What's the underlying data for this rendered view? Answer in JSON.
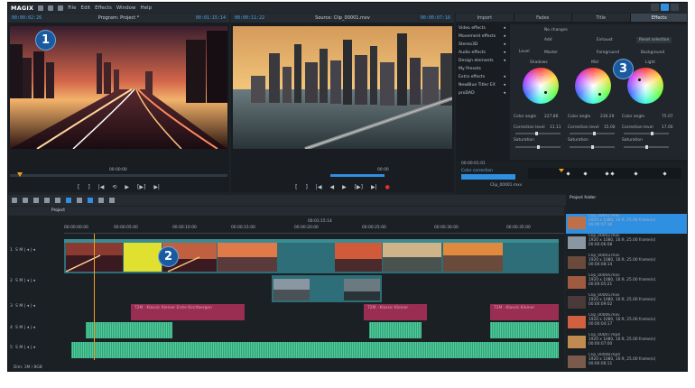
{
  "app": {
    "logo": "MAGIX"
  },
  "menu": [
    "File",
    "Edit",
    "Effects",
    "Window",
    "Help"
  ],
  "program_monitor": {
    "start_tc": "00:00:02:26",
    "title": "Program: Project *",
    "end_tc": "00:01:15:14",
    "position_tc": "00:00:00",
    "badge": "1",
    "controls": [
      "[",
      "]",
      "|◀",
      "⟲",
      "▶",
      "[▶]",
      "▶|"
    ]
  },
  "source_monitor": {
    "start_tc": "00:00:11:22",
    "title": "Source: Clip_00001.mxv",
    "end_tc": "00:00:07:16",
    "position_tc": "00:00",
    "controls": [
      "[",
      "]",
      "|◀",
      "◀",
      "▶",
      "[▶]",
      "▶|",
      "●"
    ]
  },
  "right_tabs": [
    "Import",
    "Fades",
    "Title",
    "Effects"
  ],
  "effects_list": [
    {
      "label": "Video effects",
      "arrow": "◂"
    },
    {
      "label": "Movement effects",
      "arrow": "◂"
    },
    {
      "label": "Stereo3D",
      "arrow": "◂"
    },
    {
      "label": "Audio effects",
      "arrow": "◂"
    },
    {
      "label": "Design elements",
      "arrow": "◂"
    },
    {
      "label": "My Presets",
      "arrow": ""
    },
    {
      "label": "Extra effects",
      "arrow": "◂"
    },
    {
      "label": "NewBlue Titler EX",
      "arrow": "◂"
    },
    {
      "label": "proDAD",
      "arrow": "◂"
    }
  ],
  "color_panel": {
    "badge": "3",
    "no_changes": "No changes",
    "add": "Add",
    "exhaust": "Exhaust",
    "reset_selection": "Reset selection",
    "level": "Level",
    "master": "Master",
    "foreground": "Foreground",
    "background": "Background",
    "wheels": [
      {
        "name": "Shadows",
        "angle_label": "Color angle",
        "angle": "227.86",
        "level_label": "Correction level",
        "level": "11.11",
        "sat_label": "Saturation"
      },
      {
        "name": "Mid",
        "angle_label": "Color angle",
        "angle": "236.29",
        "level_label": "Correction level",
        "level": "15.00",
        "sat_label": "Saturation"
      },
      {
        "name": "Light",
        "angle_label": "Color angle",
        "angle": "75.07",
        "level_label": "Correction level",
        "level": "17.00",
        "sat_label": "Saturation"
      }
    ]
  },
  "keyframe_panel": {
    "tc": "00:00:01:01",
    "track": "Color correction",
    "clip": "Clip_00001.mxv"
  },
  "timeline": {
    "project_tab": "Project",
    "ruler": [
      "00:00:00:00",
      "00:00:05:00",
      "00:00:10:00",
      "00:00:15:00",
      "00:00:20:00",
      "00:00:25:00",
      "00:00:30:00",
      "00:00:35:00"
    ],
    "center_tc": "00:01:15:14",
    "badge": "2",
    "track_labels": [
      "1",
      "2",
      "3",
      "4",
      "5"
    ],
    "title_clips": [
      "T2M · Klassic Kleiner Erste Kirchbergen",
      "T2M · Klassic Kleiner",
      "T2M · Klassic Kleiner"
    ],
    "status": "Dim: 1M / 8GB"
  },
  "project_folder": {
    "title": "Project folder",
    "items": [
      {
        "name": "Clip_00001.mxv",
        "meta": "1920 x 1080, 16:9, 25.00 frame(s)",
        "dur": "00:00:07:16"
      },
      {
        "name": "Clip_00002.mxv",
        "meta": "1920 x 1080, 16:9, 25.00 frame(s)",
        "dur": "00:00:06:08"
      },
      {
        "name": "Clip_00003.mxv",
        "meta": "1920 x 1080, 16:9, 25.00 frame(s)",
        "dur": "00:00:08:14"
      },
      {
        "name": "Clip_00004.mxv",
        "meta": "1920 x 1080, 16:9, 25.00 frame(s)",
        "dur": "00:00:05:21"
      },
      {
        "name": "Clip_00005.mxv",
        "meta": "1920 x 1080, 16:9, 25.00 frame(s)",
        "dur": "00:00:09:02"
      },
      {
        "name": "Clip_00006.mxv",
        "meta": "1920 x 1080, 16:9, 25.00 frame(s)",
        "dur": "00:00:04:17"
      },
      {
        "name": "Clip_00007.mp4",
        "meta": "1920 x 1080, 16:9, 25.00 frame(s)",
        "dur": "00:00:07:00"
      },
      {
        "name": "Clip_00008.mp4",
        "meta": "1920 x 1080, 16:9, 25.00 frame(s)",
        "dur": "00:00:06:11"
      }
    ]
  },
  "colors": {
    "accent": "#2f8fe0",
    "badge": "#1a5aa0",
    "audio": "#2fa57a",
    "title_clip": "#b0335a",
    "video_clip": "#2d6e78"
  }
}
